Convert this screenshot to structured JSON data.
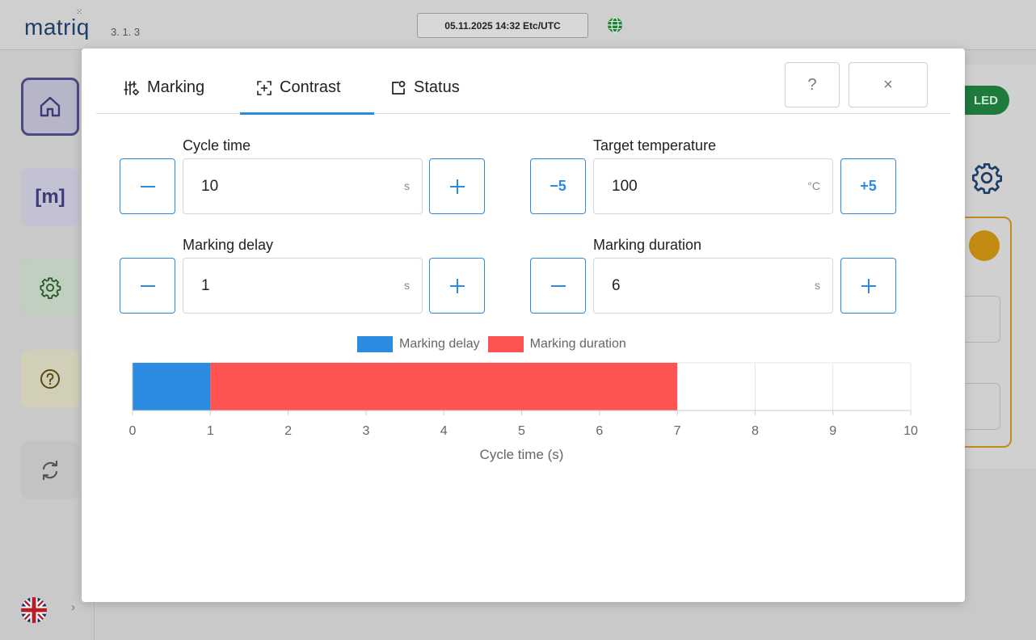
{
  "app": {
    "logo_text": "matriq",
    "logo_dots": "⁙",
    "version": "3. 1. 3",
    "datetime": "05.11.2025 14:32 Etc/UTC",
    "led_label": "LED"
  },
  "modal": {
    "tabs": [
      {
        "label": "Marking",
        "icon": "sliders-icon",
        "active": false
      },
      {
        "label": "Contrast",
        "icon": "contrast-icon",
        "active": true
      },
      {
        "label": "Status",
        "icon": "status-icon",
        "active": false
      }
    ],
    "help_label": "?",
    "close_label": "×",
    "fields": {
      "cycle_time": {
        "label": "Cycle time",
        "value": "10",
        "unit": "s",
        "dec_label": "−",
        "inc_label": "+"
      },
      "target_temperature": {
        "label": "Target temperature",
        "value": "100",
        "unit": "°C",
        "dec_label": "−5",
        "inc_label": "+5"
      },
      "marking_delay": {
        "label": "Marking delay",
        "value": "1",
        "unit": "s",
        "dec_label": "−",
        "inc_label": "+"
      },
      "marking_duration": {
        "label": "Marking duration",
        "value": "6",
        "unit": "s",
        "dec_label": "−",
        "inc_label": "+"
      }
    }
  },
  "chart_data": {
    "type": "bar",
    "orientation": "horizontal",
    "stacked": true,
    "series": [
      {
        "name": "Marking delay",
        "start": 0,
        "value": 1,
        "color": "#2b8be0"
      },
      {
        "name": "Marking duration",
        "start": 1,
        "value": 6,
        "color": "#ff5252"
      }
    ],
    "xlabel": "Cycle time (s)",
    "xlim": [
      0,
      10
    ],
    "xticks": [
      "0",
      "1",
      "2",
      "3",
      "4",
      "5",
      "6",
      "7",
      "8",
      "9",
      "10"
    ],
    "grid": true,
    "legend": "top"
  },
  "colors": {
    "accent": "#2b8be0",
    "delay": "#2b8be0",
    "duration": "#ff5252"
  }
}
